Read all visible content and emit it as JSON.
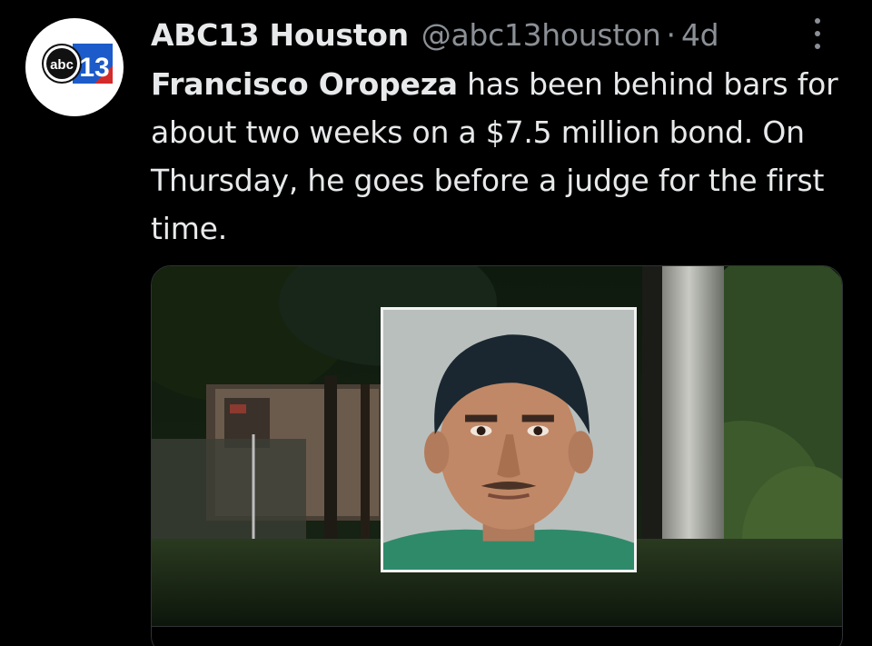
{
  "tweet": {
    "author": {
      "display_name": "ABC13 Houston",
      "handle": "@abc13houston",
      "separator": "·",
      "time": "4d",
      "avatar": {
        "logo_text_small": "abc",
        "logo_text_large": "13",
        "colors": {
          "blue": "#1c5bc9",
          "red": "#d32a2a",
          "white": "#ffffff",
          "black": "#111111"
        }
      }
    },
    "text": {
      "bold_name": "Francisco Oropeza",
      "rest": " has been behind bars for about two weeks on a $7.5 million bond. On Thursday, he goes before a judge for the first time."
    },
    "media": {
      "alt": "",
      "icon": "photo"
    },
    "more_icon": "more-vertical-icon"
  },
  "colors": {
    "background": "#000000",
    "primary_text": "#e7e9ea",
    "secondary_text": "#8b9096"
  }
}
